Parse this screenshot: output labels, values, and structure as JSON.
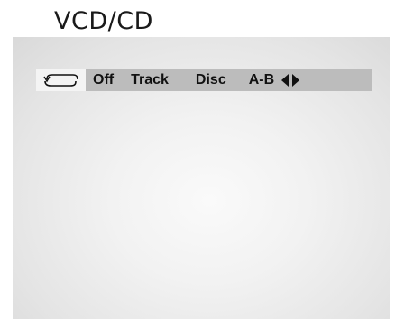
{
  "heading": "VCD/CD",
  "osd": {
    "repeat_icon": "repeat-icon",
    "options": [
      "Off",
      "Track",
      "Disc",
      "A-B"
    ],
    "arrows_icon": "left-right-arrows-icon"
  },
  "colors": {
    "bar": "#bcbcbc",
    "icon_box": "#f4f4f4",
    "text": "#111111"
  }
}
